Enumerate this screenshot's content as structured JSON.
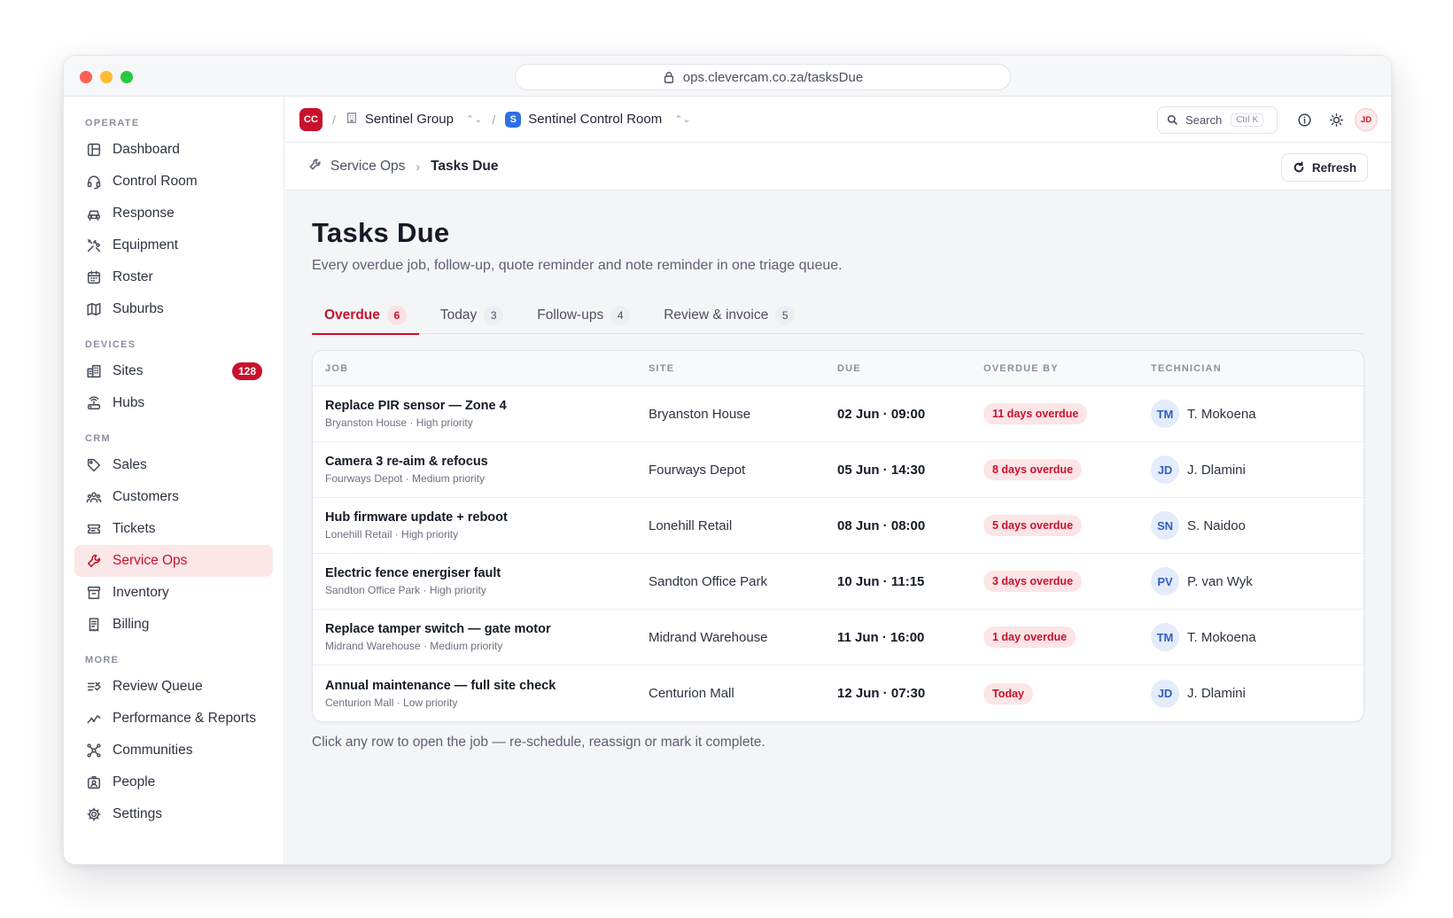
{
  "browser": {
    "url": "ops.clevercam.co.za/tasksDue"
  },
  "sidebar": {
    "sections": [
      {
        "label": "OPERATE",
        "items": [
          {
            "label": "Dashboard",
            "icon": "layout-icon"
          },
          {
            "label": "Control Room",
            "icon": "headset-icon"
          },
          {
            "label": "Response",
            "icon": "car-icon"
          },
          {
            "label": "Equipment",
            "icon": "tools-icon"
          },
          {
            "label": "Roster",
            "icon": "calendar-icon"
          },
          {
            "label": "Suburbs",
            "icon": "map-icon"
          }
        ]
      },
      {
        "label": "DEVICES",
        "items": [
          {
            "label": "Sites",
            "icon": "building-icon",
            "badge": "128"
          },
          {
            "label": "Hubs",
            "icon": "router-icon"
          }
        ]
      },
      {
        "label": "CRM",
        "items": [
          {
            "label": "Sales",
            "icon": "tag-icon"
          },
          {
            "label": "Customers",
            "icon": "users-icon"
          },
          {
            "label": "Tickets",
            "icon": "ticket-icon"
          },
          {
            "label": "Service Ops",
            "icon": "wrench-icon",
            "active": true
          },
          {
            "label": "Inventory",
            "icon": "archive-icon"
          },
          {
            "label": "Billing",
            "icon": "receipt-icon"
          }
        ]
      },
      {
        "label": "MORE",
        "items": [
          {
            "label": "Review Queue",
            "icon": "list-check-icon"
          },
          {
            "label": "Performance & Reports",
            "icon": "trend-icon"
          },
          {
            "label": "Communities",
            "icon": "network-icon"
          },
          {
            "label": "People",
            "icon": "badge-icon"
          },
          {
            "label": "Settings",
            "icon": "gear-icon"
          }
        ]
      }
    ]
  },
  "topbar": {
    "org_initials": "CC",
    "group": "Sentinel Group",
    "room_initial": "S",
    "room": "Sentinel Control Room",
    "search_label": "Search",
    "search_shortcut": "Ctrl K",
    "user_initials": "JD"
  },
  "breadcrumb": {
    "parent": "Service Ops",
    "current": "Tasks Due",
    "refresh_label": "Refresh"
  },
  "page": {
    "title": "Tasks Due",
    "subtitle": "Every overdue job, follow-up, quote reminder and note reminder in one triage queue.",
    "footnote": "Click any row to open the job — re-schedule, reassign or mark it complete."
  },
  "tabs": [
    {
      "label": "Overdue",
      "count": "6",
      "active": true
    },
    {
      "label": "Today",
      "count": "3"
    },
    {
      "label": "Follow-ups",
      "count": "4"
    },
    {
      "label": "Review & invoice",
      "count": "5"
    }
  ],
  "table": {
    "headers": [
      "JOB",
      "SITE",
      "DUE",
      "OVERDUE BY",
      "TECHNICIAN"
    ],
    "rows": [
      {
        "job": "Replace PIR sensor — Zone 4",
        "meta": "Bryanston House · High priority",
        "site": "Bryanston House",
        "due": "02 Jun · 09:00",
        "overdue": "11 days overdue",
        "tech_initials": "TM",
        "tech": "T. Mokoena"
      },
      {
        "job": "Camera 3 re-aim & refocus",
        "meta": "Fourways Depot · Medium priority",
        "site": "Fourways Depot",
        "due": "05 Jun · 14:30",
        "overdue": "8 days overdue",
        "tech_initials": "JD",
        "tech": "J. Dlamini"
      },
      {
        "job": "Hub firmware update + reboot",
        "meta": "Lonehill Retail · High priority",
        "site": "Lonehill Retail",
        "due": "08 Jun · 08:00",
        "overdue": "5 days overdue",
        "tech_initials": "SN",
        "tech": "S. Naidoo"
      },
      {
        "job": "Electric fence energiser fault",
        "meta": "Sandton Office Park · High priority",
        "site": "Sandton Office Park",
        "due": "10 Jun · 11:15",
        "overdue": "3 days overdue",
        "tech_initials": "PV",
        "tech": "P. van Wyk"
      },
      {
        "job": "Replace tamper switch — gate motor",
        "meta": "Midrand Warehouse · Medium priority",
        "site": "Midrand Warehouse",
        "due": "11 Jun · 16:00",
        "overdue": "1 day overdue",
        "tech_initials": "TM",
        "tech": "T. Mokoena"
      },
      {
        "job": "Annual maintenance — full site check",
        "meta": "Centurion Mall · Low priority",
        "site": "Centurion Mall",
        "due": "12 Jun · 07:30",
        "overdue": "Today",
        "tech_initials": "JD",
        "tech": "J. Dlamini"
      }
    ]
  },
  "colors": {
    "accent": "#c8122d",
    "info": "#2f6fe4"
  }
}
